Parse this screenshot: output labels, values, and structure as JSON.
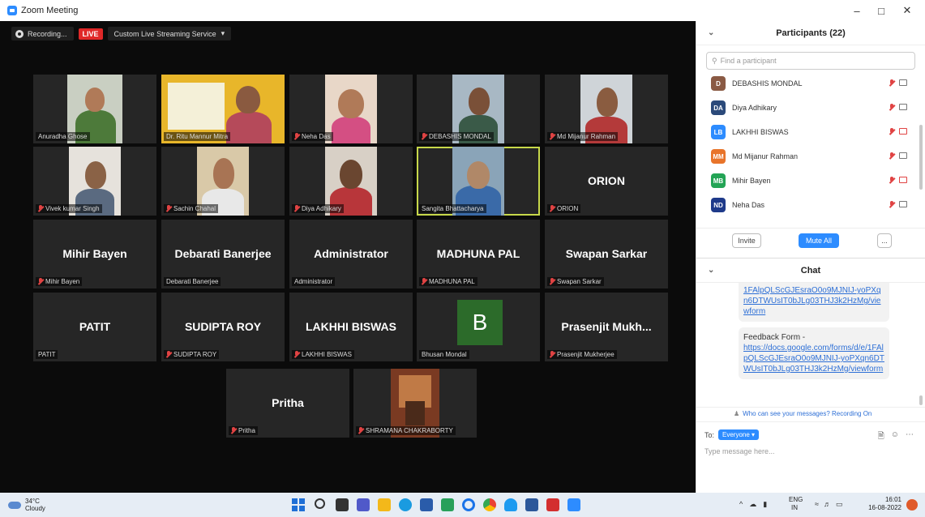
{
  "window": {
    "title": "Zoom Meeting"
  },
  "topbar": {
    "recording": "Recording...",
    "live": "LIVE",
    "stream": "Custom Live Streaming Service"
  },
  "tiles": [
    {
      "name": "Anuradha Ghose",
      "big": ""
    },
    {
      "name": "Dr. Ritu Mannur Mitra",
      "big": ""
    },
    {
      "name": "Neha Das",
      "big": ""
    },
    {
      "name": "DEBASHIS MONDAL",
      "big": ""
    },
    {
      "name": "Md Mijanur Rahman",
      "big": ""
    },
    {
      "name": "Vivek kumar Singh",
      "big": ""
    },
    {
      "name": "Sachin Chahal",
      "big": ""
    },
    {
      "name": "Diya Adhikary",
      "big": ""
    },
    {
      "name": "Sangita Bhattacharya",
      "big": ""
    },
    {
      "name": "ORION",
      "big": "ORION"
    },
    {
      "name": "Mihir Bayen",
      "big": "Mihir Bayen"
    },
    {
      "name": "Debarati Banerjee",
      "big": "Debarati Banerjee"
    },
    {
      "name": "Administrator",
      "big": "Administrator"
    },
    {
      "name": "MADHUNA PAL",
      "big": "MADHUNA PAL"
    },
    {
      "name": "Swapan Sarkar",
      "big": "Swapan Sarkar"
    },
    {
      "name": "PATIT",
      "big": "PATIT"
    },
    {
      "name": "SUDIPTA ROY",
      "big": "SUDIPTA ROY"
    },
    {
      "name": "LAKHHI BISWAS",
      "big": "LAKHHI BISWAS"
    },
    {
      "name": "Bhusan Mondal",
      "big": "B"
    },
    {
      "name": "Prasenjit Mukherjee",
      "big": "Prasenjit Mukh..."
    },
    {
      "name": "Pritha",
      "big": "Pritha"
    },
    {
      "name": "SHRAMANA CHAKRABORTY",
      "big": ""
    }
  ],
  "participants": {
    "title": "Participants (22)",
    "search_placeholder": "Find a participant",
    "list": [
      {
        "initials": "D",
        "name": "DEBASHIS MONDAL",
        "color": "#8a5a44",
        "cam_off": false
      },
      {
        "initials": "DA",
        "name": "Diya Adhikary",
        "color": "#2b4a7a",
        "cam_off": false
      },
      {
        "initials": "LB",
        "name": "LAKHHI BISWAS",
        "color": "#2d8cff",
        "cam_off": true
      },
      {
        "initials": "MM",
        "name": "Md Mijanur Rahman",
        "color": "#e8742a",
        "cam_off": false
      },
      {
        "initials": "MB",
        "name": "Mihir Bayen",
        "color": "#23a455",
        "cam_off": true
      },
      {
        "initials": "ND",
        "name": "Neha Das",
        "color": "#1e3a8a",
        "cam_off": false
      }
    ],
    "invite": "Invite",
    "mute_all": "Mute All",
    "more": "..."
  },
  "chat": {
    "title": "Chat",
    "msg1_link": "1FAlpQLScGJEsraO0o9MJNIJ-yoPXqn6DTWUsIT0bJLg03THJ3k2HzMg/viewform",
    "msg2_label": "Feedback Form -",
    "msg2_link": "https://docs.google.com/forms/d/e/1FAlpQLScGJEsraO0o9MJNIJ-yoPXqn6DTWUsIT0bJLg03THJ3k2HzMg/viewform",
    "notice": "Who can see your messages? Recording On",
    "to_label": "To:",
    "to_value": "Everyone",
    "placeholder": "Type message here..."
  },
  "taskbar": {
    "temp": "34°C",
    "weather": "Cloudy",
    "lang": "ENG",
    "region": "IN",
    "time": "16:01",
    "date": "16-08-2022"
  },
  "colors": {
    "zoom_blue": "#2d8cff",
    "live_red": "#e02828",
    "active_speaker": "#c7d84a"
  }
}
